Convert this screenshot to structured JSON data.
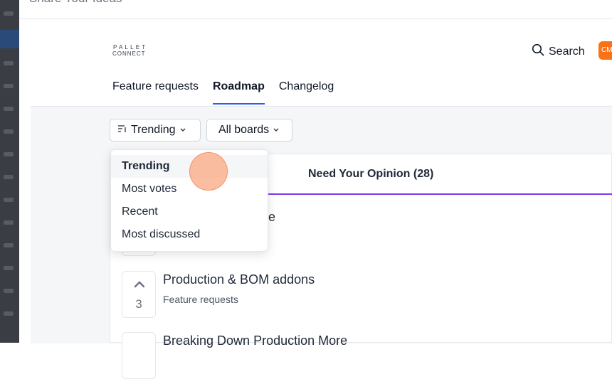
{
  "window": {
    "title": "Share Your Ideas"
  },
  "brand": {
    "logo_line1": "PALLET",
    "logo_line2": "CONNECT"
  },
  "header": {
    "search_label": "Search",
    "avatar_initials": "CM",
    "avatar_color": "#f97316"
  },
  "nav": {
    "tabs": [
      {
        "label": "Feature requests",
        "active": false
      },
      {
        "label": "Roadmap",
        "active": true
      },
      {
        "label": "Changelog",
        "active": false
      }
    ],
    "active_color": "#2563eb"
  },
  "filters": {
    "sort_label": "Trending",
    "board_label": "All boards"
  },
  "sort_menu": {
    "options": [
      "Trending",
      "Most votes",
      "Recent",
      "Most discussed"
    ],
    "selected": "Trending"
  },
  "column": {
    "title": "Need Your Opinion (28)",
    "accent_color": "#7c3aed"
  },
  "items": [
    {
      "title_partial": "e",
      "votes": ""
    },
    {
      "title": "Production & BOM addons",
      "board": "Feature requests",
      "votes": "3"
    },
    {
      "title": "Breaking Down Production More"
    }
  ]
}
